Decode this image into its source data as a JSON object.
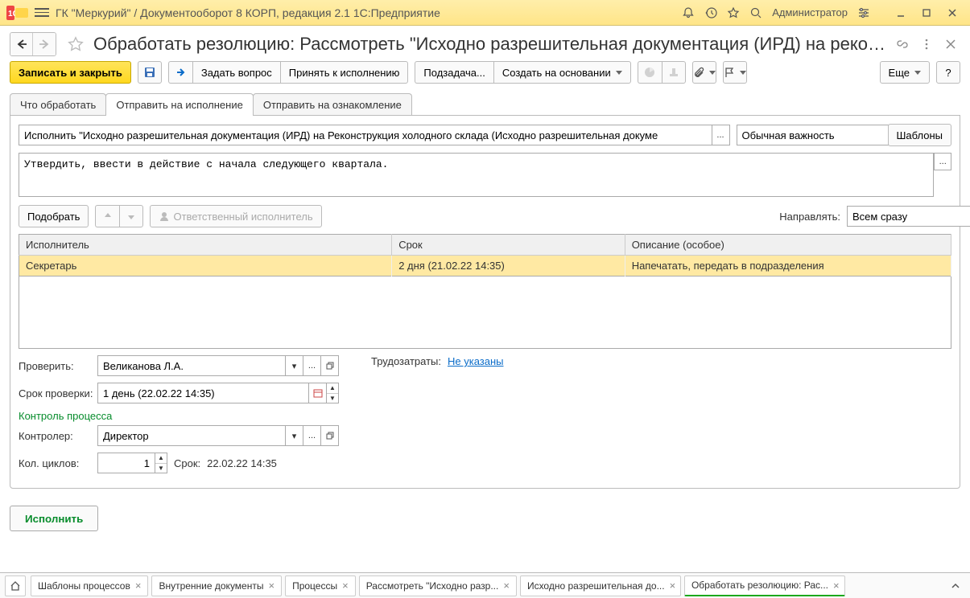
{
  "titlebar": {
    "app_title": "ГК \"Меркурий\" / Документооборот 8 КОРП, редакция 2.1 1С:Предприятие",
    "user": "Администратор"
  },
  "page": {
    "title": "Обработать резолюцию: Рассмотреть \"Исходно разрешительная документация (ИРД) на реконструкц..."
  },
  "toolbar": {
    "save_close": "Записать и закрыть",
    "ask_question": "Задать вопрос",
    "accept_exec": "Принять к исполнению",
    "subtask": "Подзадача...",
    "create_based": "Создать на основании",
    "more": "Еще"
  },
  "tabs": {
    "t1": "Что обработать",
    "t2": "Отправить на исполнение",
    "t3": "Отправить на ознакомление"
  },
  "form": {
    "task_name": "Исполнить \"Исходно разрешительная документация (ИРД) на Реконструкция холодного склада (Исходно разрешительная докуме",
    "importance": "Обычная важность",
    "templates_btn": "Шаблоны",
    "description": "Утвердить, ввести в действие с начала следующего квартала.",
    "pick_btn": "Подобрать",
    "responsible": "Ответственный исполнитель",
    "direct_label": "Направлять:",
    "direct_value": "Всем сразу",
    "table": {
      "col_executor": "Исполнитель",
      "col_deadline": "Срок",
      "col_desc": "Описание (особое)",
      "row1": {
        "executor": "Секретарь",
        "deadline": "2 дня (21.02.22 14:35)",
        "desc": "Напечатать, передать в подразделения"
      }
    },
    "check_label": "Проверить:",
    "check_value": "Великанова Л.А.",
    "effort_label": "Трудозатраты:",
    "effort_value": "Не указаны",
    "check_deadline_label": "Срок проверки:",
    "check_deadline_value": "1 день (22.02.22 14:35)",
    "section_control": "Контроль процесса",
    "controller_label": "Контролер:",
    "controller_value": "Директор",
    "cycles_label": "Кол. циклов:",
    "cycles_value": "1",
    "deadline_label": "Срок:",
    "deadline_value": "22.02.22 14:35",
    "execute_btn": "Исполнить"
  },
  "bottom_tabs": {
    "t1": "Шаблоны процессов",
    "t2": "Внутренние документы",
    "t3": "Процессы",
    "t4": "Рассмотреть \"Исходно разр...",
    "t5": "Исходно разрешительная до...",
    "t6": "Обработать резолюцию: Рас..."
  }
}
